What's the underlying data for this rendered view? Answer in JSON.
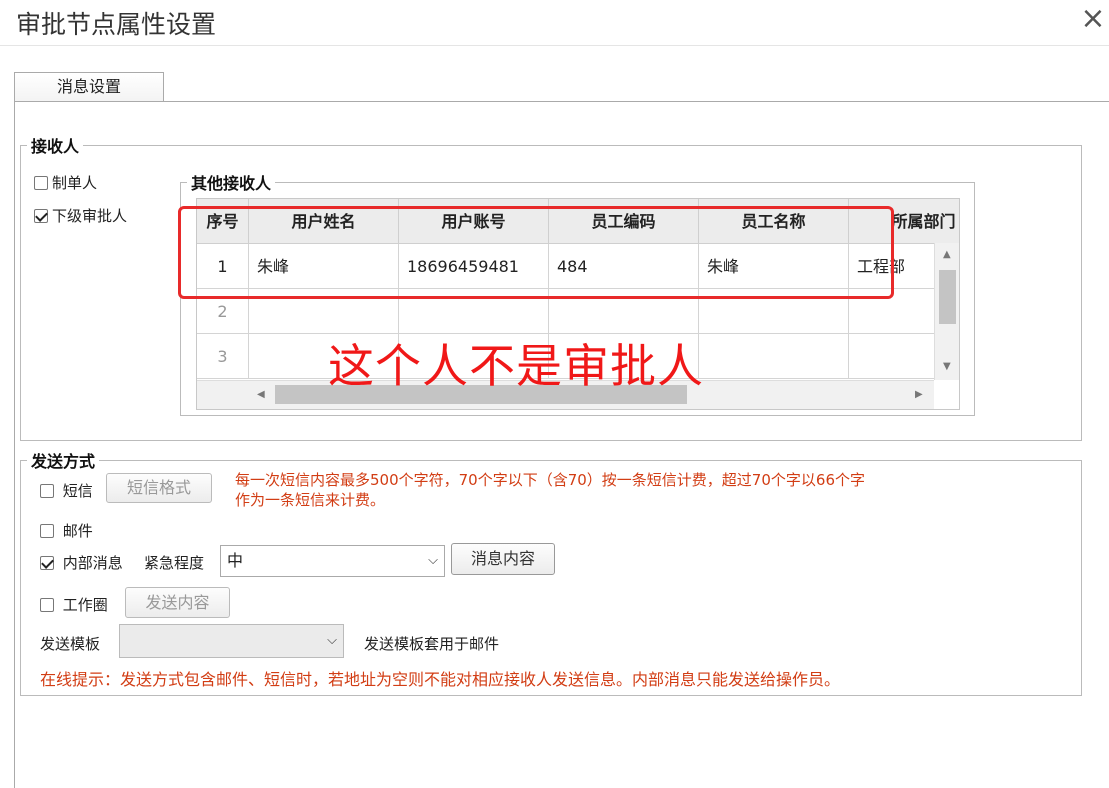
{
  "dialog": {
    "title": "审批节点属性设置",
    "close": "×"
  },
  "tabs": [
    {
      "label": "消息设置"
    }
  ],
  "receivers": {
    "legend": "接收人",
    "creator": {
      "label": "制单人",
      "checked": false
    },
    "next_approver": {
      "label": "下级审批人",
      "checked": true
    },
    "others": {
      "legend": "其他接收人",
      "columns": [
        "序号",
        "用户姓名",
        "用户账号",
        "员工编码",
        "员工名称",
        "所属部门"
      ],
      "rows": [
        [
          "1",
          "朱峰",
          "18696459481",
          "484",
          "朱峰",
          "工程部"
        ],
        [
          "2",
          "",
          "",
          "",
          "",
          ""
        ],
        [
          "3",
          "",
          "",
          "",
          "",
          ""
        ]
      ]
    },
    "annotation": "这个人不是审批人"
  },
  "send_methods": {
    "legend": "发送方式",
    "sms": {
      "label": "短信",
      "checked": false,
      "format_button": "短信格式"
    },
    "sms_note_line1": "每一次短信内容最多500个字符，70个字以下（含70）按一条短信计费，超过70个字以66个字",
    "sms_note_line2": "作为一条短信来计费。",
    "email": {
      "label": "邮件",
      "checked": false
    },
    "internal": {
      "label": "内部消息",
      "checked": true,
      "urgency_label": "紧急程度",
      "urgency_value": "中",
      "content_button": "消息内容"
    },
    "work_circle": {
      "label": "工作圈",
      "checked": false,
      "send_button": "发送内容"
    },
    "template": {
      "label": "发送模板",
      "value": "",
      "note": "发送模板套用于邮件"
    },
    "online_tip": "在线提示：发送方式包含邮件、短信时，若地址为空则不能对相应接收人发送信息。内部消息只能发送给操作员。"
  },
  "colors": {
    "annotation": "#f01818",
    "note": "#d23d14"
  }
}
